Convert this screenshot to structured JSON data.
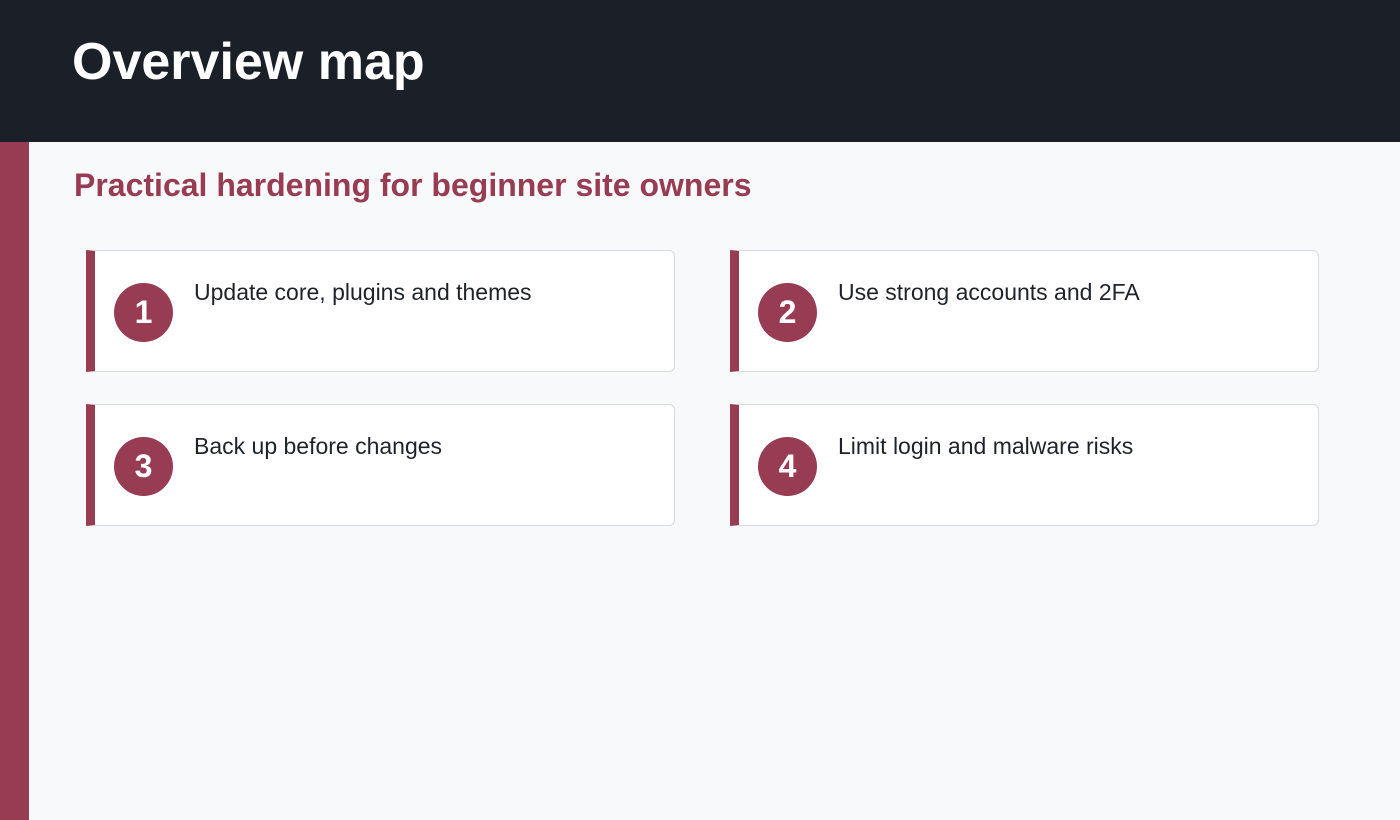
{
  "header": {
    "title": "Overview map"
  },
  "subtitle": "Practical hardening for beginner site owners",
  "cards": [
    {
      "number": "1",
      "text": "Update core, plugins and themes"
    },
    {
      "number": "2",
      "text": "Use strong accounts and 2FA"
    },
    {
      "number": "3",
      "text": "Back up before changes"
    },
    {
      "number": "4",
      "text": "Limit login and malware risks"
    }
  ],
  "colors": {
    "header_bg": "#1b2028",
    "accent": "#983c54",
    "page_bg": "#f8f9fb",
    "card_border": "#d6dbe1"
  }
}
